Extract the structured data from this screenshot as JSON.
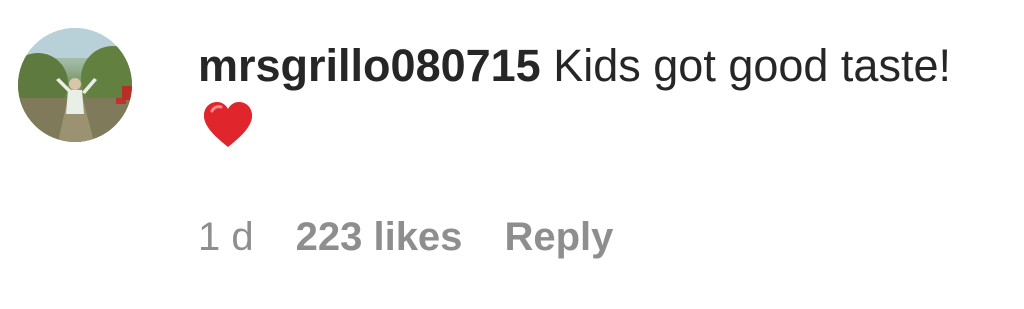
{
  "comment": {
    "username": "mrsgrillo080715",
    "text": " Kids got good taste! ",
    "emoji": "red-heart-icon",
    "avatar": "profile-photo-avatar",
    "time": "1 d",
    "likes": "223 likes",
    "reply_label": "Reply"
  },
  "colors": {
    "text": "#262626",
    "meta": "#8e8e8e",
    "heart": "#e0252d"
  }
}
